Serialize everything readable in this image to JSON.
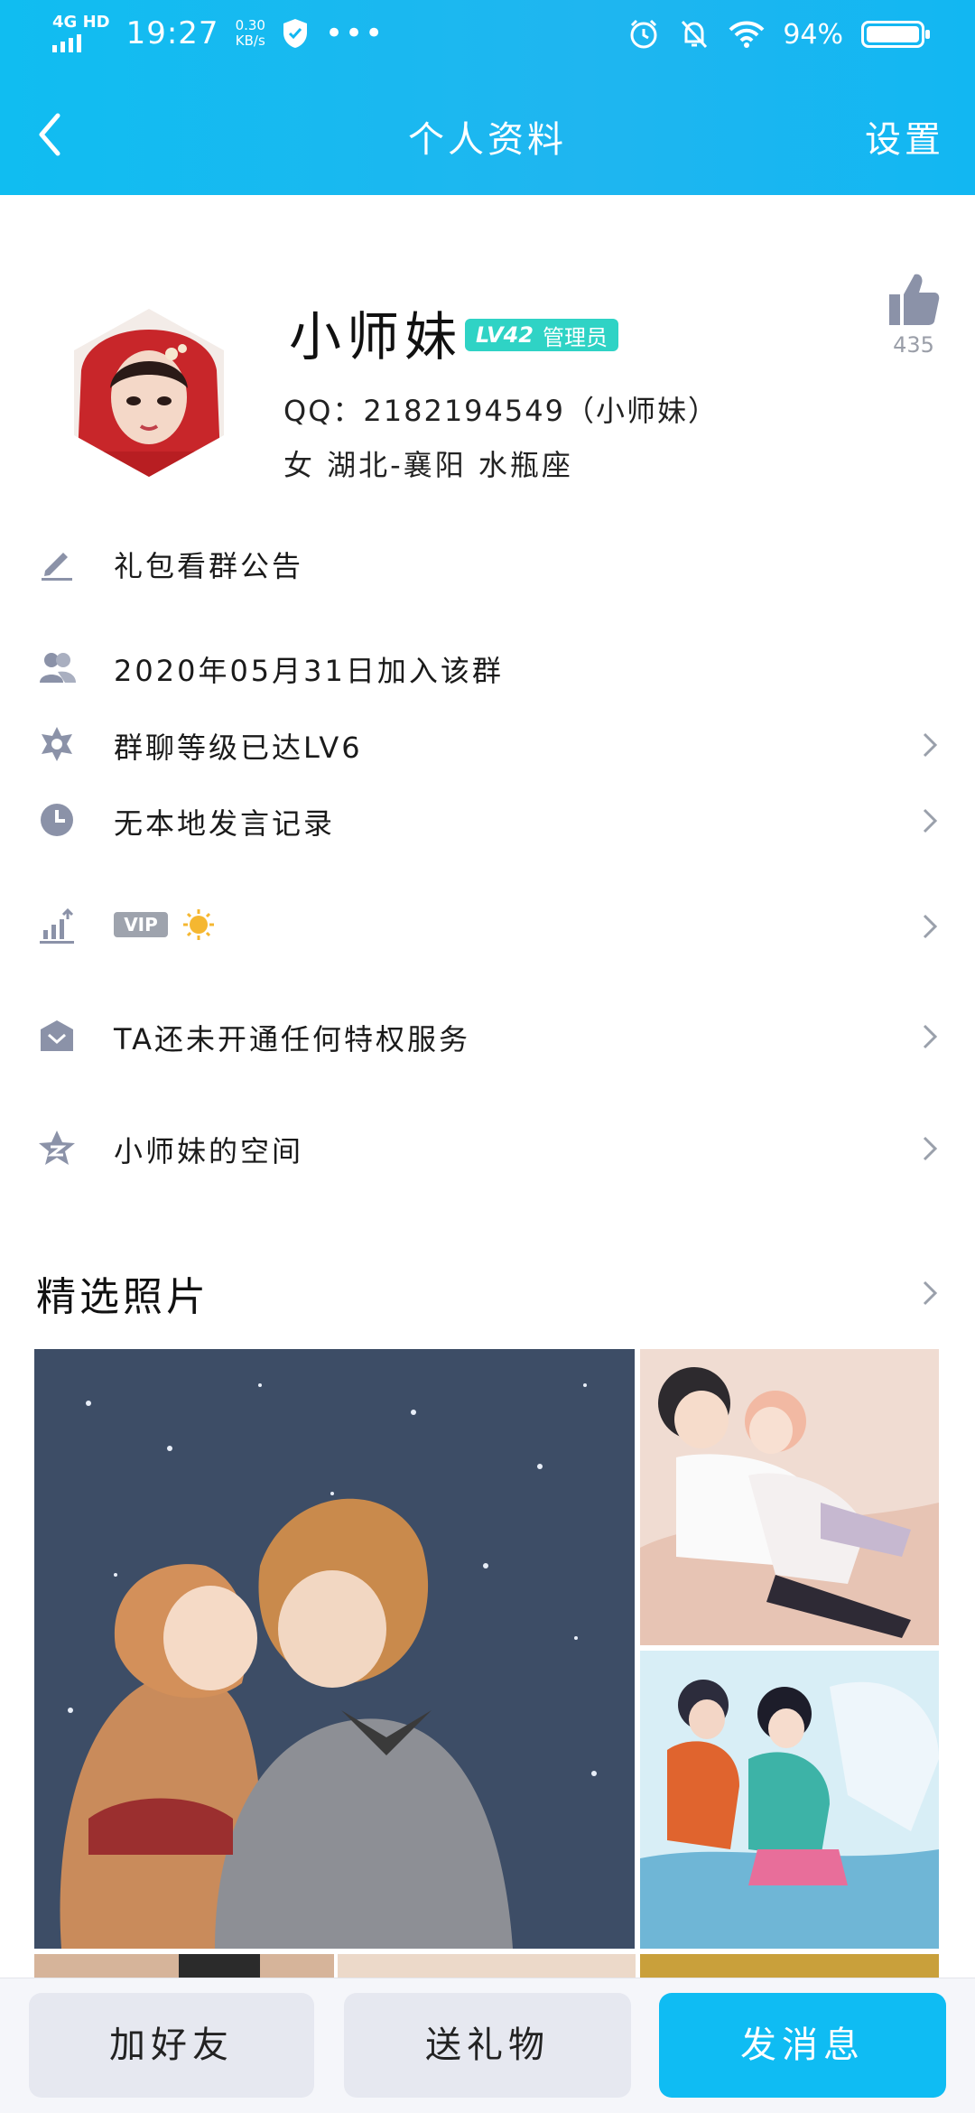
{
  "status_bar": {
    "network": "4G HD",
    "time": "19:27",
    "speed_value": "0.30",
    "speed_unit": "KB/s",
    "battery": "94%"
  },
  "nav": {
    "title": "个人资料",
    "settings": "设置"
  },
  "profile": {
    "name": "小师妹",
    "level": "LV42",
    "role": "管理员",
    "qq": "QQ：2182194549（小师妹）",
    "info": "女  湖北-襄阳  水瓶座",
    "likes": "435"
  },
  "rows": {
    "announcement": "礼包看群公告",
    "join_date": "2020年05月31日加入该群",
    "group_level": "群聊等级已达LV6",
    "history": "无本地发言记录",
    "vip": "VIP",
    "privilege": "TA还未开通任何特权服务",
    "space": "小师妹的空间"
  },
  "photos": {
    "title": "精选照片"
  },
  "bottom": {
    "add_friend": "加好友",
    "send_gift": "送礼物",
    "send_message": "发消息"
  },
  "colors": {
    "header": "#12b7f2",
    "accent": "#0fbcf3",
    "badge": "#2fd3c5",
    "icon": "#8b92a8"
  }
}
